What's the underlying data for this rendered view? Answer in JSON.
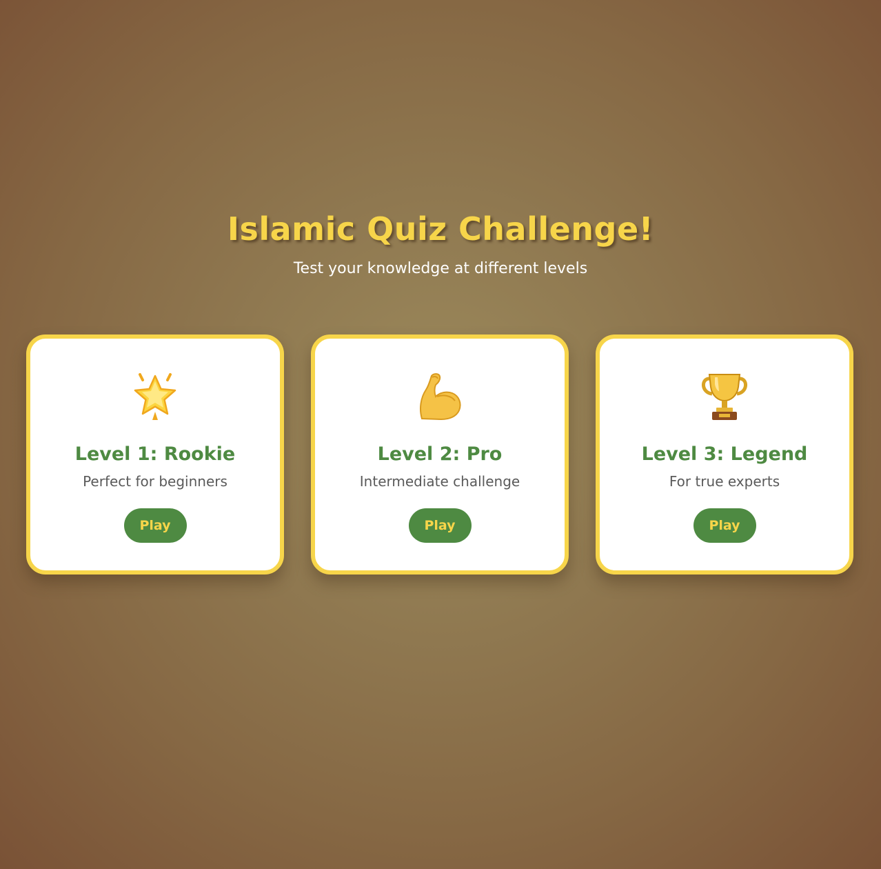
{
  "header": {
    "title": "Islamic Quiz Challenge!",
    "subtitle": "Test your knowledge at different levels"
  },
  "levels": [
    {
      "icon": "glowing-star-icon",
      "title": "Level 1: Rookie",
      "description": "Perfect for beginners",
      "button_label": "Play"
    },
    {
      "icon": "flexed-bicep-icon",
      "title": "Level 2: Pro",
      "description": "Intermediate challenge",
      "button_label": "Play"
    },
    {
      "icon": "trophy-icon",
      "title": "Level 3: Legend",
      "description": "For true experts",
      "button_label": "Play"
    }
  ],
  "colors": {
    "accent_yellow": "#f7d54a",
    "button_green": "#4e8a42",
    "title_green": "#4e8a42",
    "description_gray": "#5a5a5a",
    "card_background": "#ffffff",
    "page_background": "#8f7850"
  }
}
